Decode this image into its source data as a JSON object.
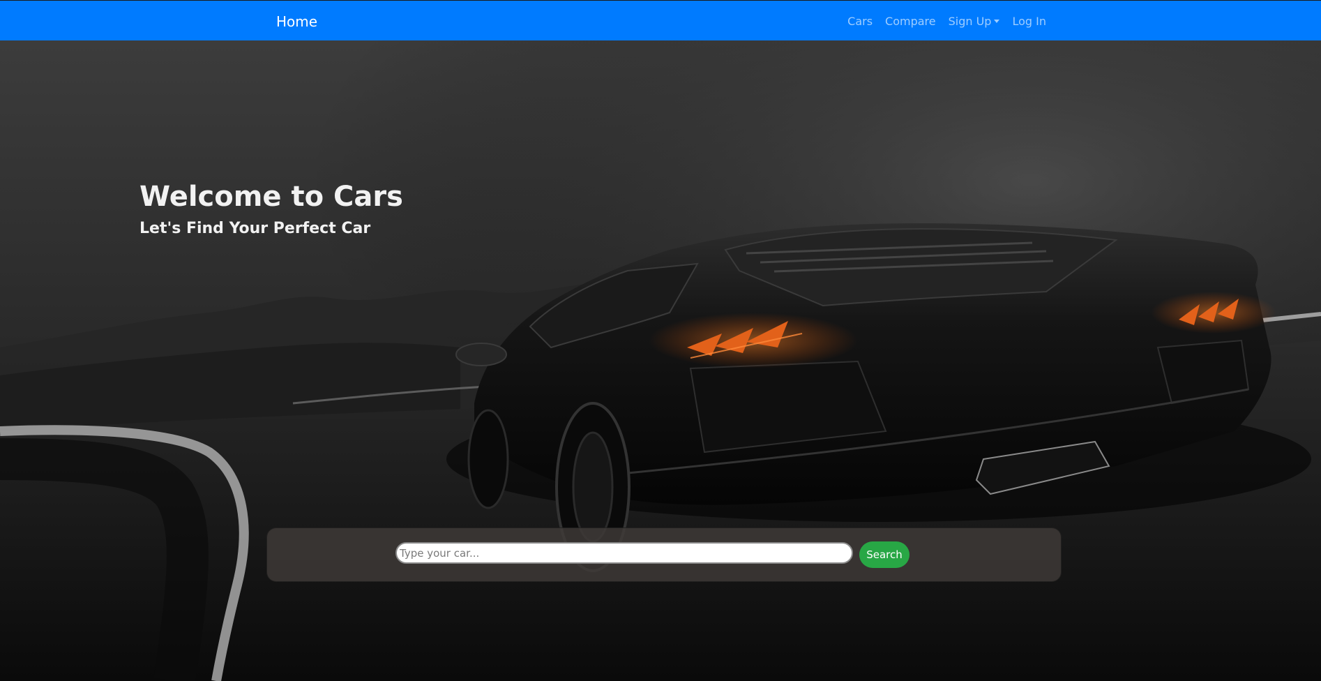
{
  "navbar": {
    "brand": "Home",
    "links": {
      "cars": "Cars",
      "compare": "Compare",
      "signup": "Sign Up",
      "login": "Log In"
    }
  },
  "hero": {
    "title": "Welcome to Cars",
    "subtitle": "Let's Find Your Perfect Car"
  },
  "search": {
    "placeholder": "Type your car...",
    "value": "",
    "button_label": "Search"
  },
  "colors": {
    "navbar_bg": "#007bff",
    "search_button_bg": "#28a745",
    "taillight": "#e2611a"
  },
  "icons": {
    "signup_dropdown": "caret-down-icon"
  }
}
